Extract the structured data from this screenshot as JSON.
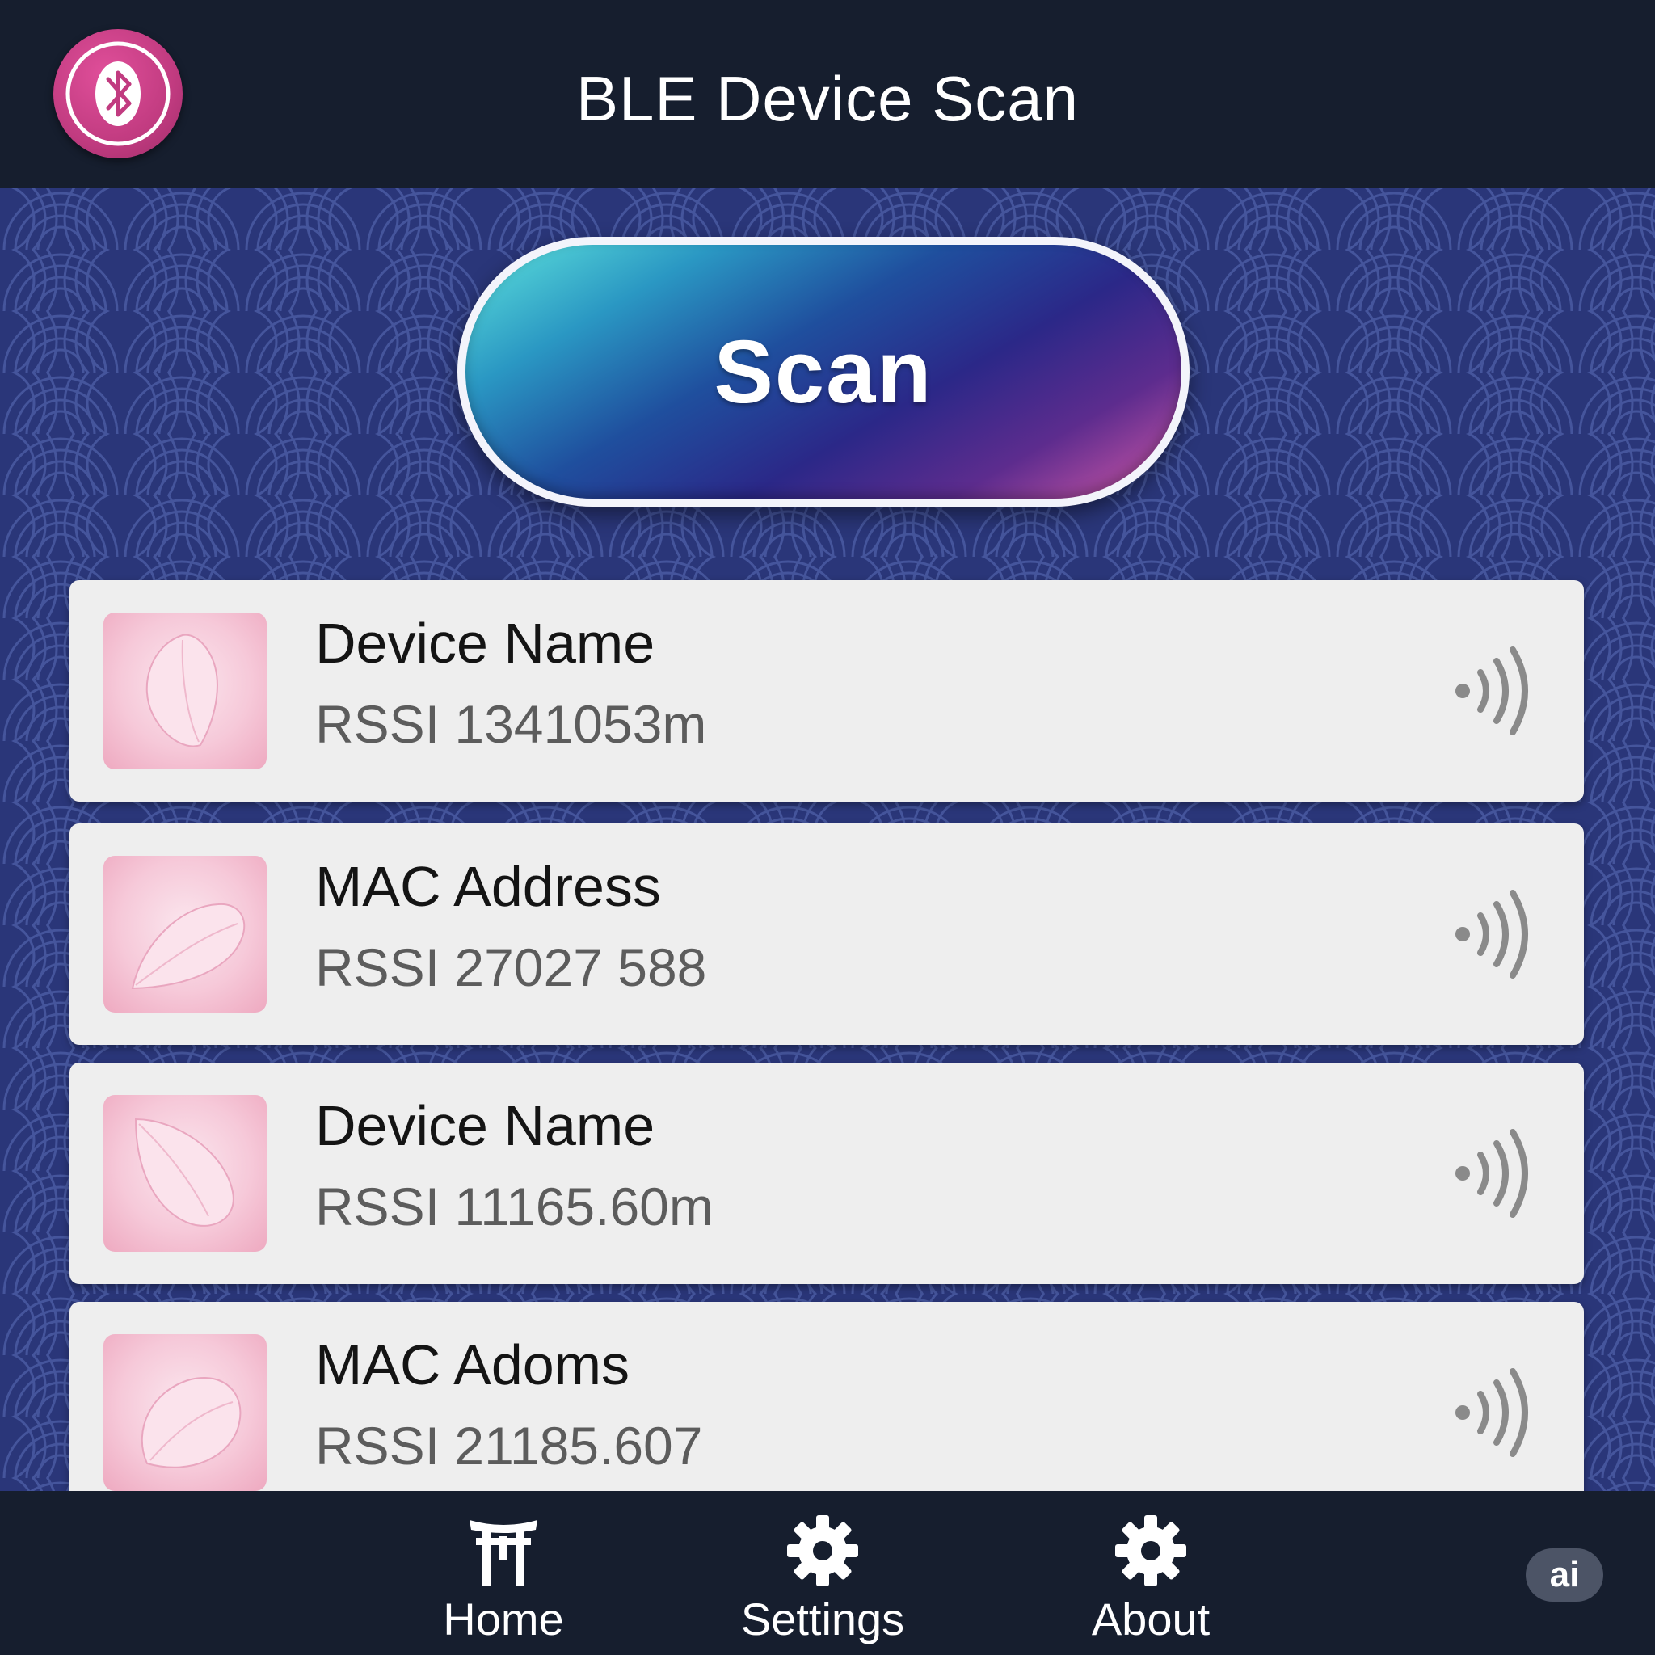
{
  "header": {
    "title": "BLE Device Scan",
    "logo_icon": "bluetooth-icon"
  },
  "scan_button": {
    "label": "Scan"
  },
  "devices": [
    {
      "title": "Device Name",
      "subtitle": "RSSI 1341053m",
      "thumb_icon": "sakura-petal-icon",
      "signal_icon": "signal-waves-icon"
    },
    {
      "title": "MAC Address",
      "subtitle": "RSSI 27027 588",
      "thumb_icon": "sakura-petal-icon",
      "signal_icon": "signal-waves-icon"
    },
    {
      "title": "Device Name",
      "subtitle": "RSSI 11165.60m",
      "thumb_icon": "sakura-petal-icon",
      "signal_icon": "signal-waves-icon"
    },
    {
      "title": "MAC Adoms",
      "subtitle": "RSSI 21185.607",
      "thumb_icon": "sakura-petal-icon",
      "signal_icon": "signal-waves-icon"
    }
  ],
  "nav": {
    "items": [
      {
        "label": "Home",
        "icon": "torii-gate-icon"
      },
      {
        "label": "Settings",
        "icon": "gear-icon"
      },
      {
        "label": "About",
        "icon": "gear-icon"
      }
    ]
  },
  "badge": {
    "label": "ai"
  },
  "colors": {
    "header_bg": "#161e2e",
    "pattern_bg": "#2a3679",
    "card_bg": "#eeeeee",
    "logo_accent": "#c13b80",
    "scan_gradient_start": "#5ee3dc",
    "scan_gradient_end": "#d75aa8"
  }
}
